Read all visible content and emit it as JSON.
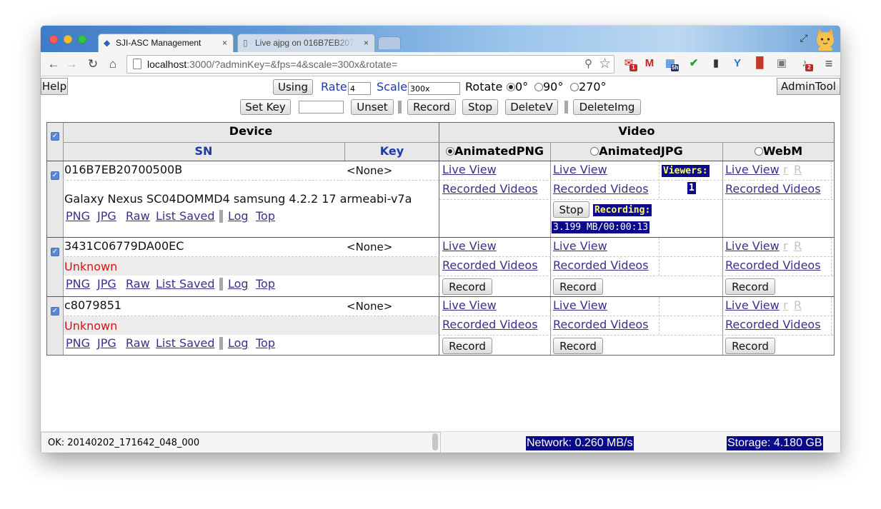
{
  "browser": {
    "tabs": [
      {
        "title": "SJI-ASC Management",
        "close": "×"
      },
      {
        "title": "Live ajpg on 016B7EB2070",
        "close": "×"
      }
    ],
    "url": {
      "host": "localhost",
      "rest": ":3000/?adminKey=&fps=4&scale=300x&rotate="
    },
    "extension_badges": {
      "gmail": "1",
      "calendar": "5h",
      "bell": "2"
    }
  },
  "toolbar": {
    "help": "Help",
    "using": "Using",
    "rate_label": "Rate",
    "rate_value": "4",
    "scale_label": "Scale",
    "scale_value": "300x",
    "rotate_label": "Rotate",
    "rotate_options": [
      "0°",
      "90°",
      "270°"
    ],
    "rotate_selected": "0°",
    "admintool": "AdminTool",
    "set_key": "Set Key",
    "key_value": "",
    "unset": "Unset",
    "record": "Record",
    "stop": "Stop",
    "delete_v": "DeleteV",
    "delete_img": "DeleteImg"
  },
  "table": {
    "header": {
      "device": "Device",
      "video": "Video",
      "sn": "SN",
      "key": "Key",
      "formats": [
        "AnimatedPNG",
        "AnimatedJPG",
        "WebM"
      ],
      "selected_format": "AnimatedPNG"
    },
    "links": {
      "live_view": "Live View",
      "recorded_videos": "Recorded Videos",
      "r1": "r",
      "r2": "R",
      "png": "PNG",
      "jpg": "JPG",
      "raw": "Raw",
      "list_saved": "List Saved",
      "log": "Log",
      "top": "Top"
    },
    "record_label": "Record",
    "stop_label": "Stop",
    "devices": [
      {
        "sn": "016B7EB20700500B",
        "key": "<None>",
        "info": "Galaxy Nexus SC04DOMMD4 samsung 4.2.2 17 armeabi-v7a",
        "viewers_label": "Viewers:",
        "viewers_count": "1",
        "recording_label": "Recording:",
        "recording_status": "3.199 MB/00:00:13"
      },
      {
        "sn": "3431C06779DA00EC",
        "key": "<None>",
        "info": "Unknown"
      },
      {
        "sn": "c8079851",
        "key": "<None>",
        "info": "Unknown"
      }
    ]
  },
  "status": {
    "message": "OK: 20140202_171642_048_000",
    "network": "Network: 0.260 MB/s",
    "storage": "Storage: 4.180 GB"
  },
  "colors": {
    "link": "#3b2f8c",
    "unknown": "#e01010",
    "badge_bg": "#0a0a8a",
    "badge_fg": "#ffff66"
  }
}
